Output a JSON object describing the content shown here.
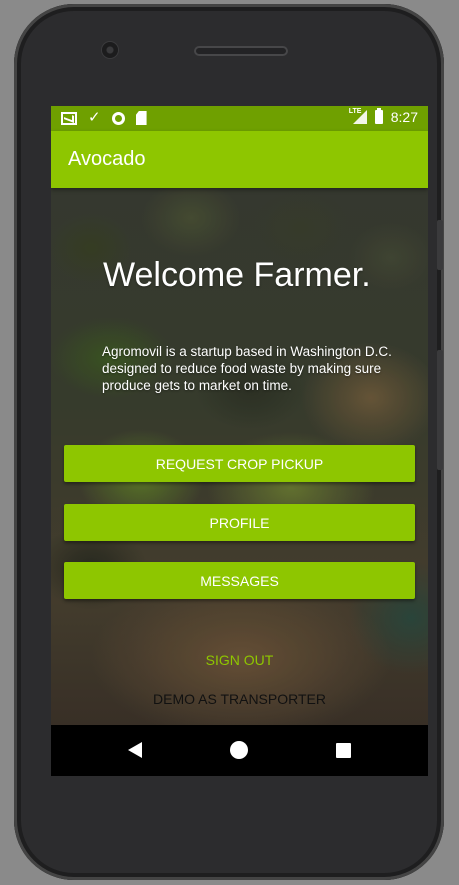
{
  "status_bar": {
    "time": "8:27",
    "network_label": "LTE",
    "left_icons": [
      "mail-icon",
      "download-done-icon",
      "circle-icon",
      "sd-card-icon"
    ],
    "right_icons": [
      "signal-icon",
      "battery-icon"
    ]
  },
  "app_bar": {
    "title": "Avocado",
    "color": "#8ec600"
  },
  "main": {
    "heading": "Welcome Farmer.",
    "description": "Agromovil is a startup based in Washington D.C. designed to reduce food waste by making sure produce gets to market on time.",
    "buttons": {
      "request_pickup": "REQUEST CROP PICKUP",
      "profile": "PROFILE",
      "messages": "MESSAGES"
    },
    "sign_out": "SIGN OUT",
    "demo_transporter": "DEMO AS TRANSPORTER",
    "background_image": "blurred-avocados-basket"
  },
  "nav_bar": {
    "icons": [
      "back-icon",
      "home-icon",
      "recents-icon"
    ]
  },
  "colors": {
    "accent": "#8ec600",
    "status_bar": "#6fa000"
  }
}
